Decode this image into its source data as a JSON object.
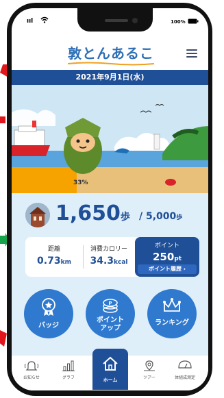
{
  "status_bar": {
    "signal": "ııl",
    "battery": "100%"
  },
  "header": {
    "logo_text": "敦とんあるこ"
  },
  "date": "2021年9月1日(水)",
  "scene": {
    "progress_label": "33%",
    "progress_fraction": 0.33
  },
  "steps": {
    "count": "1,650",
    "unit": "歩",
    "goal": "/ 5,000",
    "goal_unit": "歩"
  },
  "stats": {
    "distance": {
      "label": "距離",
      "value": "0.73",
      "unit": "km"
    },
    "calories": {
      "label": "消費カロリー",
      "value": "34.3",
      "unit": "kcal"
    },
    "points": {
      "label": "ポイント",
      "value": "250",
      "unit": "pt",
      "history_link": "ポイント履歴 ›"
    }
  },
  "actions": [
    {
      "label_line1": "バッジ",
      "label_line2": ""
    },
    {
      "label_line1": "ポイント",
      "label_line2": "アップ"
    },
    {
      "label_line1": "ランキング",
      "label_line2": ""
    }
  ],
  "tabs": [
    {
      "label": "お知らせ"
    },
    {
      "label": "グラフ"
    },
    {
      "label": "ホーム"
    },
    {
      "label": "ツアー"
    },
    {
      "label": "体組成測定"
    }
  ],
  "colors": {
    "primary": "#1f4f96",
    "accent": "#2f79cf",
    "background": "#dfeffa",
    "edge_red": "#e0161c",
    "edge_green": "#17a34a"
  }
}
